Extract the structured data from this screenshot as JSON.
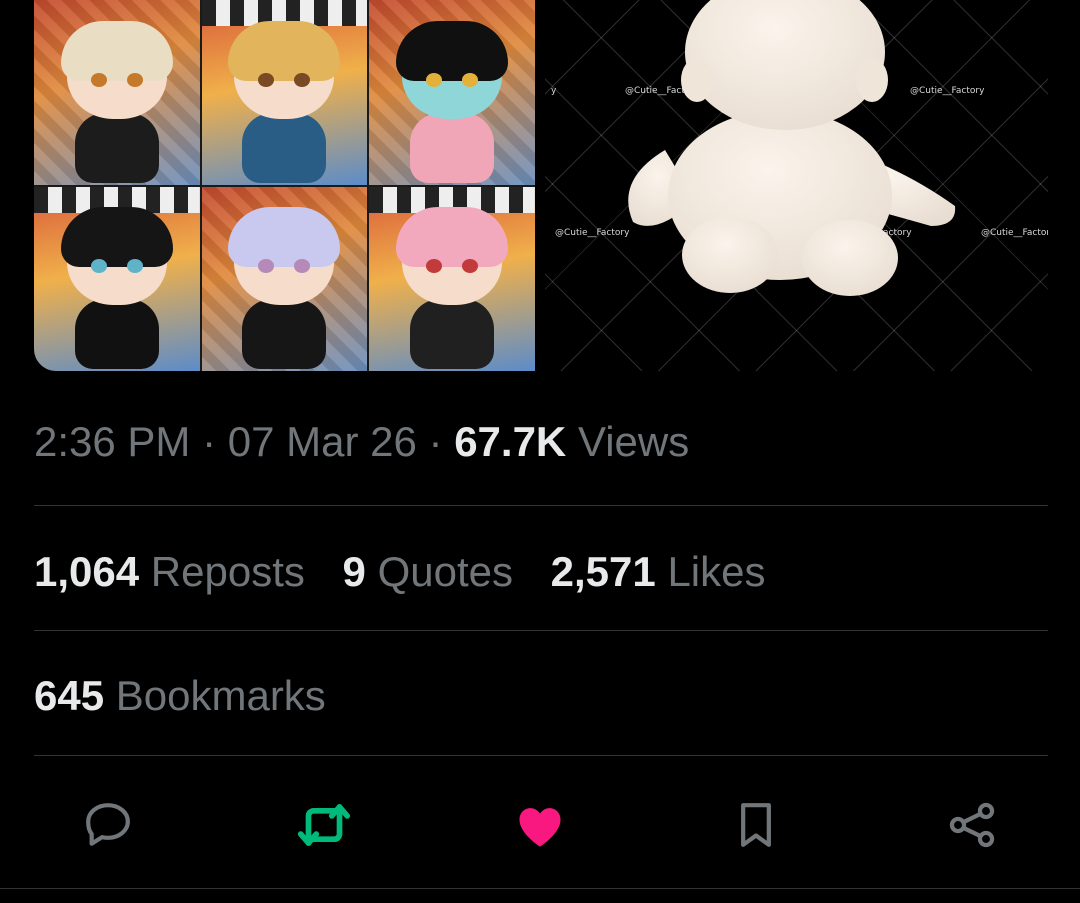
{
  "tweet": {
    "time": "2:36 PM",
    "separator": " · ",
    "date": "07 Mar 26",
    "views_count": "67.7K",
    "views_label": "Views"
  },
  "stats": {
    "reposts": {
      "count": "1,064",
      "label": "Reposts"
    },
    "quotes": {
      "count": "9",
      "label": "Quotes"
    },
    "likes": {
      "count": "2,571",
      "label": "Likes"
    },
    "bookmarks": {
      "count": "645",
      "label": "Bookmarks"
    }
  },
  "media": {
    "watermark": "@Cutie__Factory",
    "watermark_partial": "y",
    "watermark_mid": "actory",
    "watermark_end": "@Cutie__Factory"
  },
  "actions": {
    "reply_icon": "reply-icon",
    "repost_icon": "repost-icon",
    "like_icon": "heart-icon",
    "bookmark_icon": "bookmark-icon",
    "share_icon": "share-icon"
  },
  "colors": {
    "background": "#000000",
    "text_primary": "#e7e9ea",
    "text_secondary": "#71767b",
    "divider": "#2f3336",
    "repost_active": "#00ba7c",
    "like_active": "#f91880"
  }
}
